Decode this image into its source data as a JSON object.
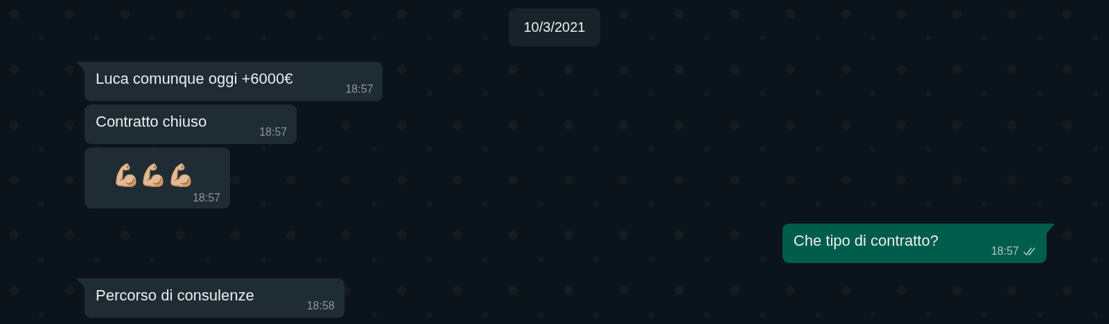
{
  "date_divider": "10/3/2021",
  "messages": [
    {
      "kind": "incoming",
      "tail": true,
      "jumbo": false,
      "text": "Luca comunque oggi +6000€",
      "time": "18:57"
    },
    {
      "kind": "incoming",
      "tail": false,
      "jumbo": false,
      "text": "Contratto chiuso",
      "time": "18:57"
    },
    {
      "kind": "incoming",
      "tail": false,
      "jumbo": true,
      "text": "💪🏼💪🏼💪🏼",
      "time": "18:57"
    },
    {
      "kind": "outgoing",
      "tail": true,
      "jumbo": false,
      "text": "Che tipo di contratto?",
      "time": "18:57",
      "read": false
    },
    {
      "kind": "incoming",
      "tail": true,
      "jumbo": false,
      "text": "Percorso di consulenze",
      "time": "18:58"
    }
  ]
}
